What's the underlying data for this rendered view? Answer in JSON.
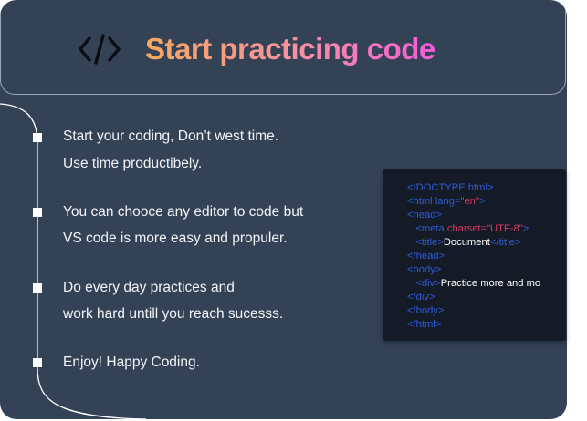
{
  "header": {
    "title": "Start practicing code",
    "icon": "code-brackets-icon"
  },
  "colors": {
    "card_bg": "#344256",
    "gradient_start": "#f7a85e",
    "gradient_end": "#f25cd9",
    "tag": "#2f5bd6",
    "attr": "#d83a64"
  },
  "tips": [
    {
      "line1": "Start your coding, Don’t west time.",
      "line2": "Use time productibely."
    },
    {
      "line1": "You can chooce any editor to code but",
      "line2": "VS  code is more easy and propuler."
    },
    {
      "line1": "Do every day practices and",
      "line2": "work hard untill you reach sucesss."
    },
    {
      "line1": "Enjoy! Happy Coding.",
      "line2": ""
    }
  ],
  "editor": {
    "doctype": "<!DOCTYPE html>",
    "html_open": "<html ",
    "html_attr": "lang=",
    "html_val": "\"en\"",
    "html_close": ">",
    "head_open": "<head>",
    "meta_open": "<meta ",
    "meta_attr": "charset=",
    "meta_val": "\"UTF-8\"",
    "meta_close": ">",
    "title_open": "<title>",
    "title_text": "Document",
    "title_close": "</title>",
    "head_close": "</head>",
    "body_open": "<body>",
    "div_open": "<div>",
    "div_text": "Practice more and mo",
    "div_close": "</div>",
    "body_close": "</body>",
    "html_end": "</html>"
  }
}
